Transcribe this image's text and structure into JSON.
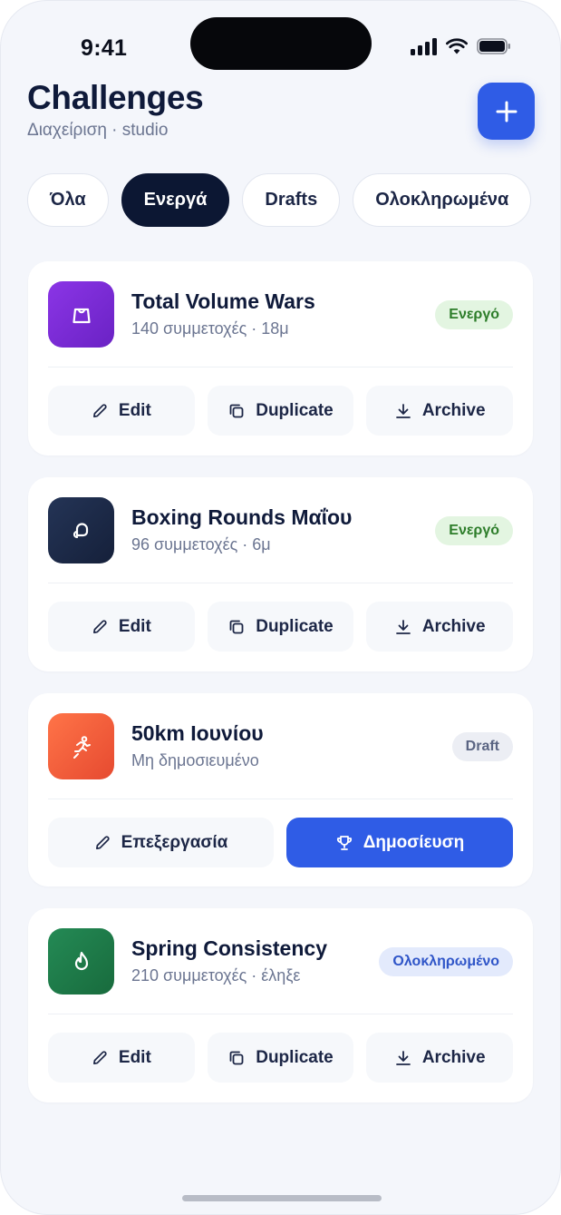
{
  "status_bar": {
    "time": "9:41"
  },
  "header": {
    "title": "Challenges",
    "subtitle": "Διαχείριση · studio"
  },
  "tabs": [
    {
      "label": "Όλα",
      "active": false
    },
    {
      "label": "Ενεργά",
      "active": true
    },
    {
      "label": "Drafts",
      "active": false
    },
    {
      "label": "Ολοκληρωμένα",
      "active": false
    }
  ],
  "cards": [
    {
      "title": "Total Volume Wars",
      "meta": "140 συμμετοχές · 18μ",
      "badge": "Ενεργό",
      "icon": "kettlebell-icon",
      "icon_color": "#7b2bd9",
      "actions": {
        "edit": "Edit",
        "duplicate": "Duplicate",
        "archive": "Archive"
      }
    },
    {
      "title": "Boxing Rounds Μαΐου",
      "meta": "96 συμμετοχές · 6μ",
      "badge": "Ενεργό",
      "icon": "boxing-glove-icon",
      "icon_color": "#1c2a48",
      "actions": {
        "edit": "Edit",
        "duplicate": "Duplicate",
        "archive": "Archive"
      }
    },
    {
      "title": "50km Ιουνίου",
      "meta": "Μη δημοσιευμένο",
      "badge": "Draft",
      "icon": "runner-icon",
      "icon_color": "#f05a3a",
      "actions": {
        "edit": "Επεξεργασία",
        "publish": "Δημοσίευση"
      }
    },
    {
      "title": "Spring Consistency",
      "meta": "210 συμμετοχές · έληξε",
      "badge": "Ολοκληρωμένο",
      "icon": "flame-icon",
      "icon_color": "#1f7a4a",
      "actions": {
        "edit": "Edit",
        "duplicate": "Duplicate",
        "archive": "Archive"
      }
    }
  ],
  "colors": {
    "accent": "#2f5ce6",
    "active_tab": "#0c1733",
    "badge_active": "#2d7d2a",
    "badge_draft": "#5a6482",
    "badge_done": "#2f55c8"
  }
}
